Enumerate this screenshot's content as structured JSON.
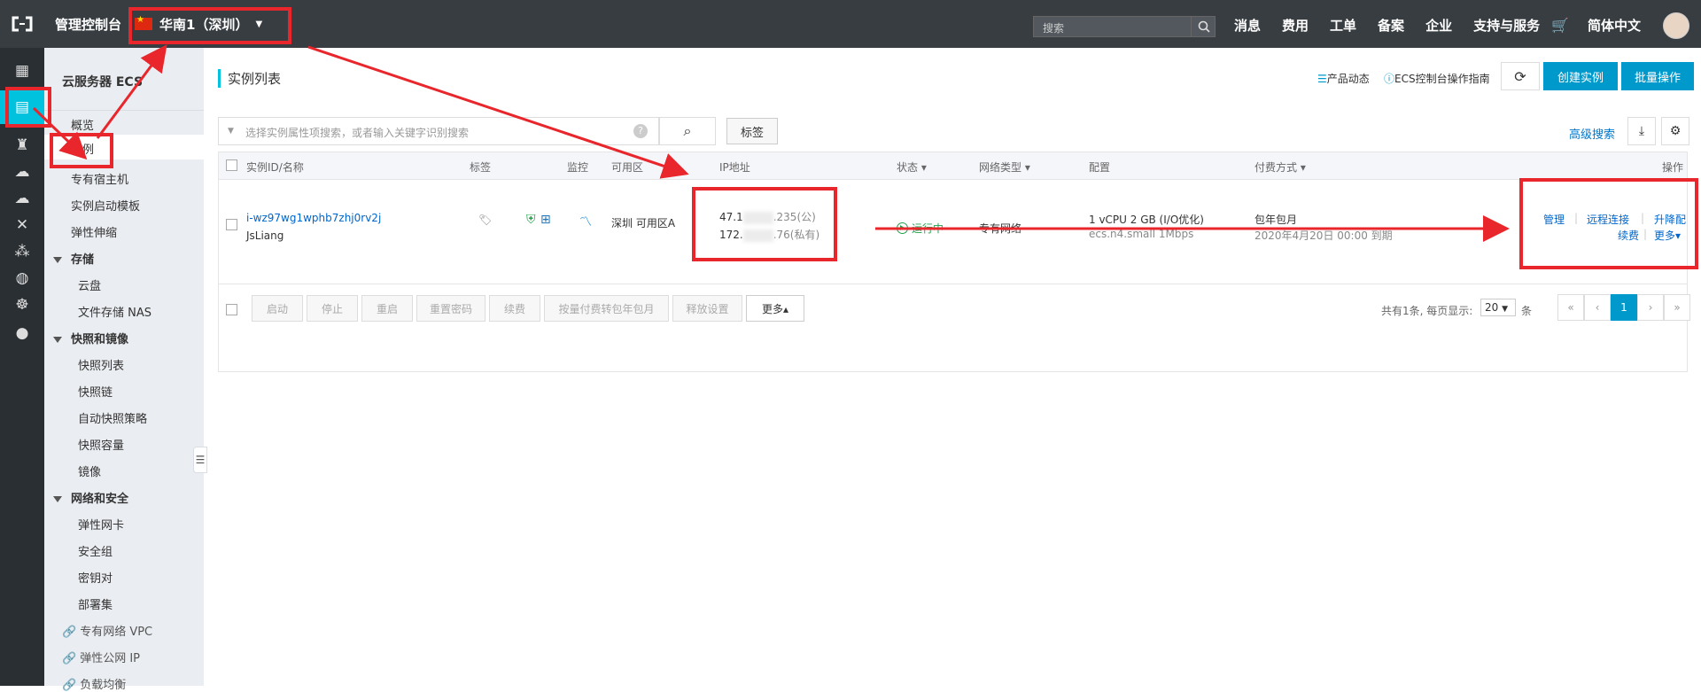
{
  "topbar": {
    "brand": "管理控制台",
    "region": "华南1（深圳）",
    "search_placeholder": "搜索",
    "nav": [
      "消息",
      "费用",
      "工单",
      "备案",
      "企业",
      "支持与服务"
    ],
    "lang": "简体中文"
  },
  "sidebar": {
    "title": "云服务器 ECS",
    "items": {
      "overview": "概览",
      "instances": "实例",
      "dedicated_host": "专有宿主机",
      "launch_template": "实例启动模板",
      "auto_scaling": "弹性伸缩",
      "storage": "存储",
      "cloud_disk": "云盘",
      "nas": "文件存储 NAS",
      "snapshots_images": "快照和镜像",
      "snapshot_list": "快照列表",
      "snapshot_chain": "快照链",
      "auto_snapshot_policy": "自动快照策略",
      "snapshot_capacity": "快照容量",
      "images": "镜像",
      "network_security": "网络和安全",
      "eni": "弹性网卡",
      "security_group": "安全组",
      "key_pair": "密钥对",
      "deployment_set": "部署集",
      "vpc": "专有网络 VPC",
      "eip": "弹性公网 IP",
      "slb": "负载均衡"
    }
  },
  "main": {
    "page_title": "实例列表",
    "product_news": "产品动态",
    "guide": "ECS控制台操作指南",
    "create_instance": "创建实例",
    "batch_ops": "批量操作",
    "search_placeholder": "选择实例属性项搜索，或者输入关键字识别搜索",
    "tag_button": "标签",
    "advanced_search": "高级搜索"
  },
  "table": {
    "columns": {
      "id_name": "实例ID/名称",
      "tags": "标签",
      "monitor": "监控",
      "zone": "可用区",
      "ip": "IP地址",
      "status": "状态",
      "network": "网络类型",
      "config": "配置",
      "billing": "付费方式",
      "actions": "操作"
    },
    "rows": [
      {
        "id": "i-wz97wg1wphb7zhj0rv2j",
        "name": "JsLiang",
        "zone": "深圳 可用区A",
        "ip_public_prefix": "47.1",
        "ip_public_suffix": ".235(公)",
        "ip_private_prefix": "172.",
        "ip_private_suffix": ".76(私有)",
        "status": "运行中",
        "network": "专有网络",
        "config_line1": "1 vCPU 2 GB (I/O优化)",
        "config_line2": "ecs.n4.small   1Mbps",
        "billing_line1": "包年包月",
        "billing_line2": "2020年4月20日 00:00 到期",
        "actions": {
          "manage": "管理",
          "remote": "远程连接",
          "upgrade": "升降配",
          "renew": "续费",
          "more": "更多"
        }
      }
    ]
  },
  "bulk_actions": [
    "启动",
    "停止",
    "重启",
    "重置密码",
    "续费",
    "按量付费转包年包月",
    "释放设置",
    "更多▴"
  ],
  "pagination": {
    "summary": "共有1条, 每页显示:",
    "page_size": "20",
    "unit": "条",
    "first": "«",
    "prev": "‹",
    "current": "1",
    "next": "›",
    "last": "»"
  },
  "colors": {
    "topbar_bg": "#373d41",
    "accent": "#00c1de",
    "primary_button": "#0099cc",
    "highlight_red": "#e8262b",
    "running_green": "#22a04b"
  }
}
